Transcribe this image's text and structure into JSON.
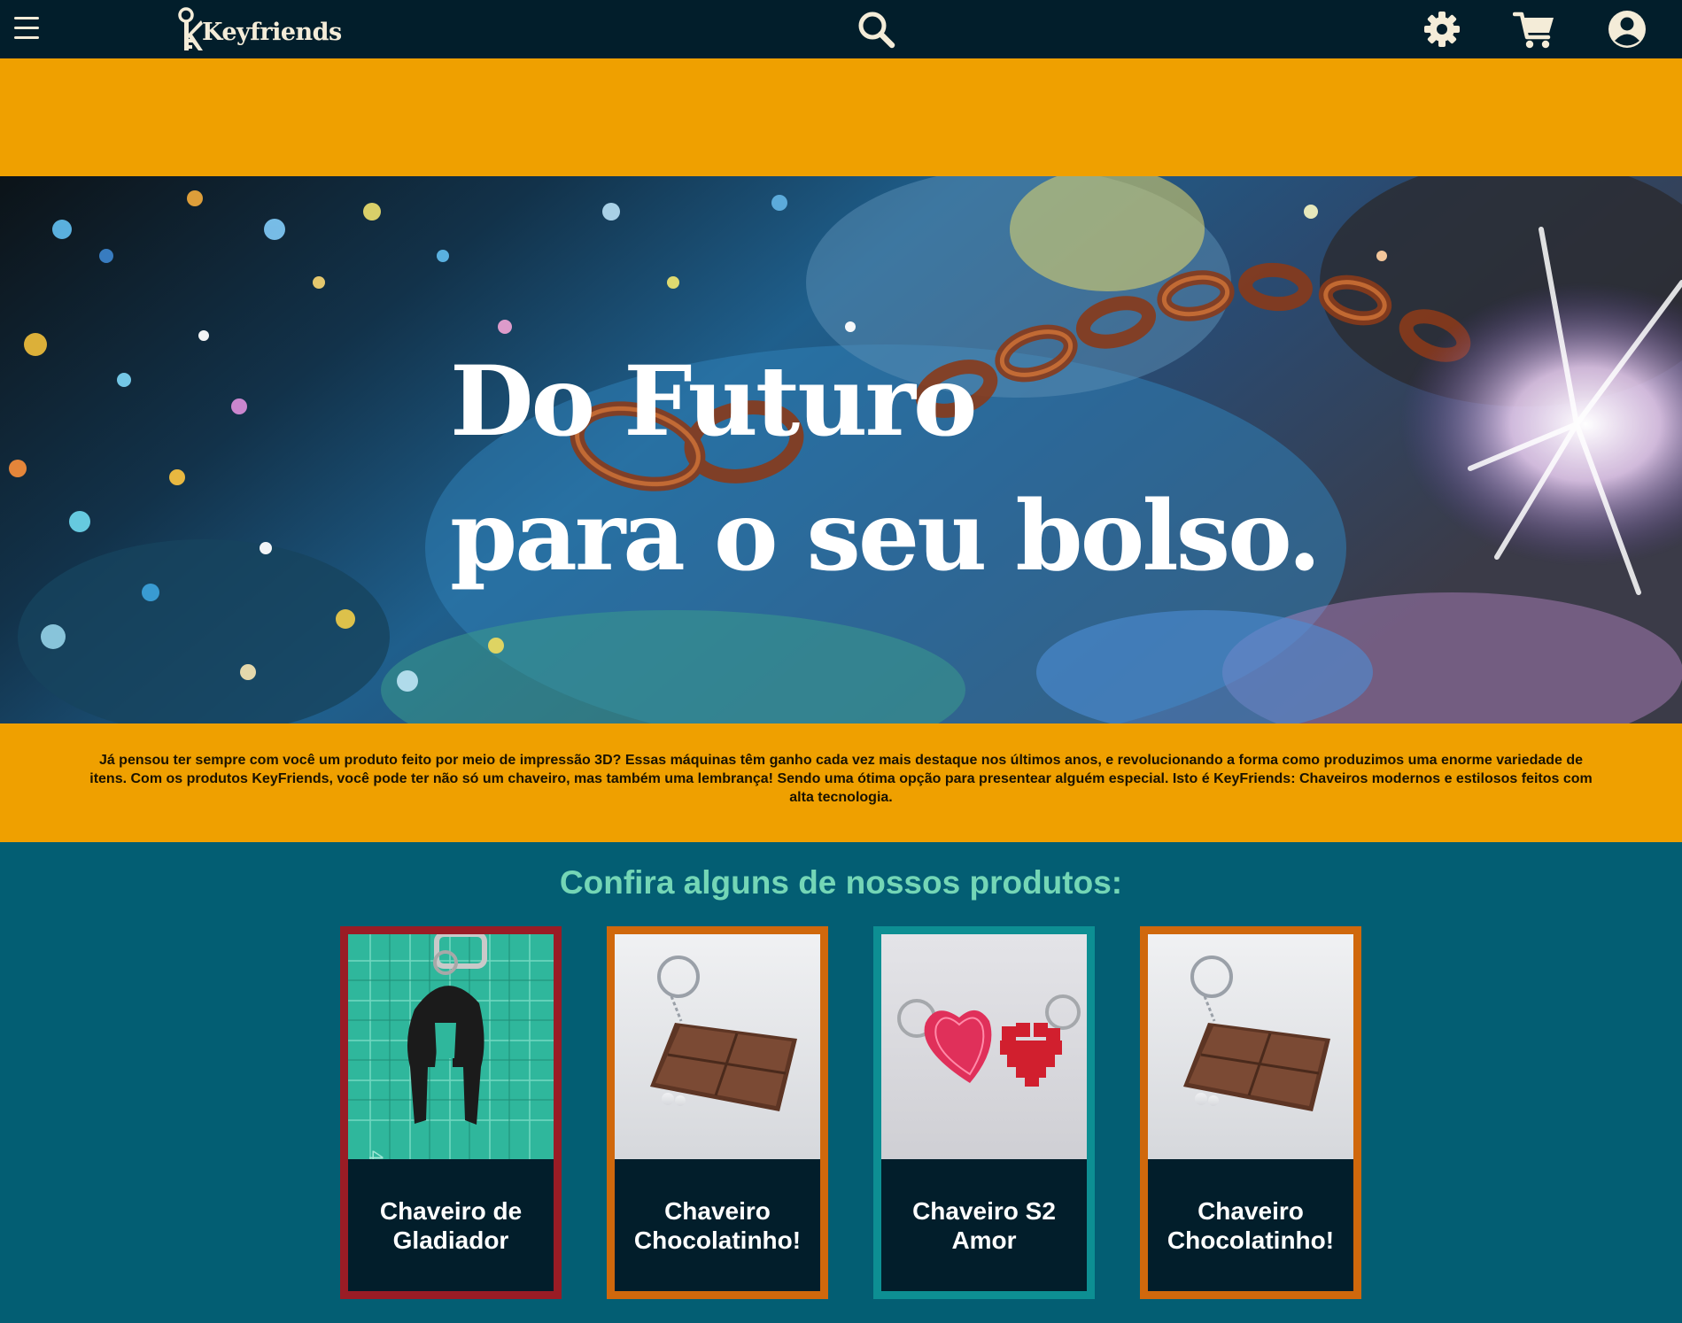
{
  "header": {
    "brand": "Keyfriends",
    "icons": [
      "menu-icon",
      "search-icon",
      "gear-icon",
      "cart-icon",
      "user-icon"
    ]
  },
  "hero": {
    "line1": "Do Futuro",
    "line2": "para o seu bolso."
  },
  "intro": {
    "text": "Já pensou ter sempre com você um produto feito por meio de impressão 3D? Essas máquinas têm ganho cada vez mais destaque nos últimos anos, e revolucionando a forma como produzimos uma enorme variedade de itens. Com os produtos KeyFriends, você pode ter não só um chaveiro, mas também uma lembrança! Sendo uma ótima opção para presentear alguém especial. Isto é KeyFriends: Chaveiros modernos e estilosos feitos com alta tecnologia."
  },
  "products": {
    "heading": "Confira alguns de nossos produtos:",
    "items": [
      {
        "name": "Chaveiro de Gladiador",
        "border_color": "#9a1c25"
      },
      {
        "name": "Chaveiro Chocolatinho!",
        "border_color": "#d0680c"
      },
      {
        "name": "Chaveiro S2 Amor",
        "border_color": "#0d8f93"
      },
      {
        "name": "Chaveiro Chocolatinho!",
        "border_color": "#d0680c"
      }
    ]
  },
  "colors": {
    "header_bg": "#021e2b",
    "accent_yellow": "#efa000",
    "section_teal": "#035e73",
    "heading_mint": "#74d6b6"
  }
}
